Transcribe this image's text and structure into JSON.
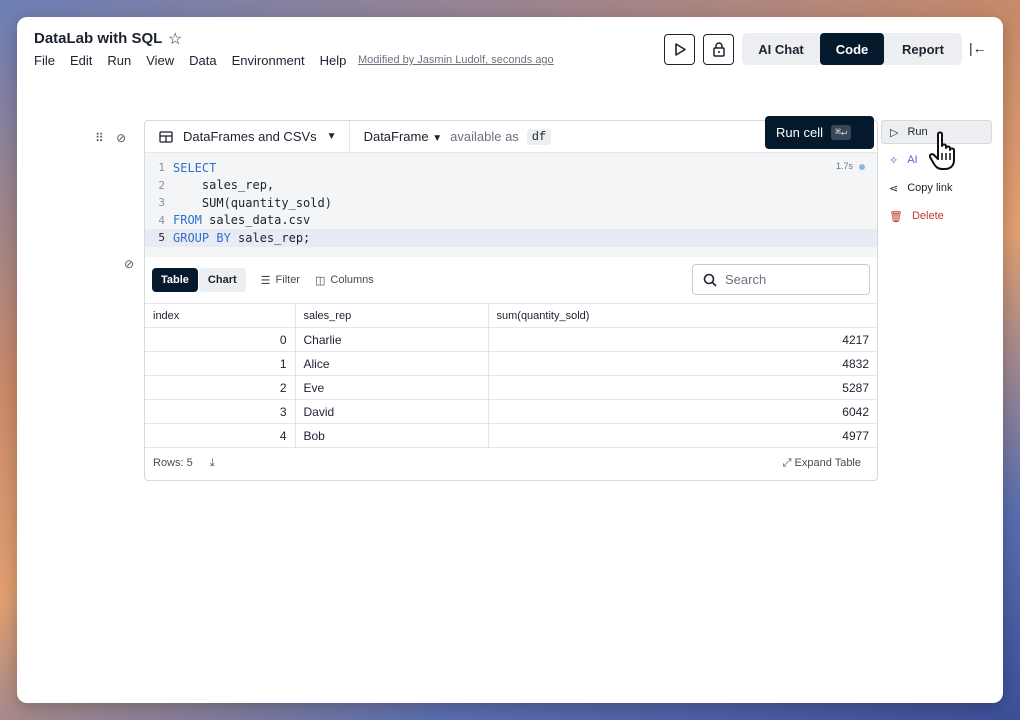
{
  "app": {
    "title": "DataLab with SQL",
    "modified": "Modified by Jasmin Ludolf, seconds ago",
    "menu": [
      "File",
      "Edit",
      "Run",
      "View",
      "Data",
      "Environment",
      "Help"
    ],
    "mode_tabs": {
      "ai_chat": "AI Chat",
      "code": "Code",
      "report": "Report"
    },
    "active_mode": "Code"
  },
  "cell": {
    "source": "DataFrames and CSVs",
    "output_type": "DataFrame",
    "available_as": "available as",
    "df_name": "df",
    "timing": "1.7s",
    "code_lines": [
      {
        "num": "1",
        "text": "SELECT"
      },
      {
        "num": "2",
        "text": "    sales_rep,"
      },
      {
        "num": "3",
        "text": "    SUM(quantity_sold)"
      },
      {
        "num": "4",
        "text": "FROM sales_data.csv"
      },
      {
        "num": "5",
        "text": "GROUP BY sales_rep;"
      }
    ],
    "active_line": 5
  },
  "results": {
    "tabs": {
      "table": "Table",
      "chart": "Chart"
    },
    "filter_label": "Filter",
    "columns_label": "Columns",
    "search_placeholder": "Search",
    "headers": [
      "index",
      "sales_rep",
      "sum(quantity_sold)"
    ],
    "rows": [
      [
        "0",
        "Charlie",
        "4217"
      ],
      [
        "1",
        "Alice",
        "4832"
      ],
      [
        "2",
        "Eve",
        "5287"
      ],
      [
        "3",
        "David",
        "6042"
      ],
      [
        "4",
        "Bob",
        "4977"
      ]
    ],
    "rows_count": "Rows: 5",
    "expand_label": "Expand Table"
  },
  "tooltip": {
    "label": "Run cell",
    "shortcut": "⌘↵"
  },
  "side_menu": {
    "run": "Run",
    "ai": "AI",
    "copy_link": "Copy link",
    "delete": "Delete"
  },
  "colors": {
    "dark": "#05192d",
    "keyword": "#2f6fd0",
    "ai": "#6d5bd0",
    "danger": "#c0392b"
  }
}
